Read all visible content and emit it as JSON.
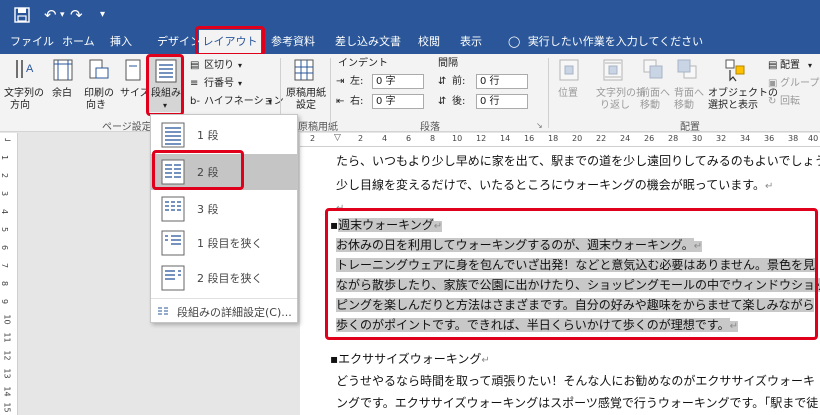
{
  "quick_access": {
    "undo": "↶",
    "redo": "↷",
    "more": "▾"
  },
  "tabs": [
    {
      "label": "ファイル"
    },
    {
      "label": "ホーム"
    },
    {
      "label": "挿入"
    },
    {
      "label": "デザイン"
    },
    {
      "label": "レイアウト"
    },
    {
      "label": "参考資料"
    },
    {
      "label": "差し込み文書"
    },
    {
      "label": "校閲"
    },
    {
      "label": "表示"
    }
  ],
  "tell_me": "実行したい作業を入力してください",
  "ribbon": {
    "page_setup": {
      "text_direction": [
        "文字列の",
        "方向"
      ],
      "margins": "余白",
      "orientation": [
        "印刷の",
        "向き"
      ],
      "size": "サイズ",
      "columns": "段組み",
      "breaks": "区切り",
      "line_numbers": "行番号",
      "hyphenation": "ハイフネーション",
      "group_label": "ページ設定"
    },
    "manuscript": {
      "button": [
        "原稿用紙",
        "設定"
      ],
      "group_label": "原稿用紙"
    },
    "paragraph": {
      "indent_label": "インデント",
      "spacing_label": "間隔",
      "left": "左:",
      "right": "右:",
      "before": "前:",
      "after": "後:",
      "left_value": "0 字",
      "right_value": "0 字",
      "before_value": "0 行",
      "after_value": "0 行",
      "group_label": "段落"
    },
    "arrange": {
      "position": "位置",
      "wrap": [
        "文字列の折",
        "り返し"
      ],
      "forward": [
        "前面へ",
        "移動"
      ],
      "backward": [
        "背面へ",
        "移動"
      ],
      "selection": [
        "オブジェクトの",
        "選択と表示"
      ],
      "align": "配置",
      "group": "グループ化",
      "rotate": "回転",
      "group_label": "配置"
    }
  },
  "ruler_numbers": [
    "2",
    "2",
    "4",
    "6",
    "8",
    "10",
    "12",
    "14",
    "16",
    "18",
    "20",
    "22",
    "24",
    "26",
    "28",
    "30",
    "32",
    "34",
    "36",
    "38",
    "40"
  ],
  "vruler_numbers": [
    "1",
    "2",
    "3",
    "4",
    "5",
    "6",
    "7",
    "8",
    "9",
    "10",
    "11",
    "12",
    "13",
    "14",
    "15"
  ],
  "columns_menu": {
    "items": [
      {
        "label": "1 段"
      },
      {
        "label": "2 段"
      },
      {
        "label": "3 段"
      },
      {
        "label": "1 段目を狭く"
      },
      {
        "label": "2 段目を狭く"
      }
    ],
    "more": "段組みの詳細設定(C)..."
  },
  "document": {
    "top_lines": [
      "たら、いつもより少し早めに家を出て、駅までの道を少し遠回りしてみるのもよいでしょう。",
      "少し目線を変えるだけで、いたるところにウォーキングの機会が眠っています。"
    ],
    "sel_heading": "週末ウォーキング",
    "sel_lines": [
      "お休みの日を利用してウォーキングするのが、週末ウォーキング。",
      "トレーニングウェアに身を包んでいざ出発！などと意気込む必要はありません。景色を見",
      "ながら散歩したり、家族で公園に出かけたり、ショッピングモールの中でウィンドウショッ",
      "ピングを楽しんだりと方法はさまざまです。自分の好みや趣味をからませて楽しみながら",
      "歩くのがポイントです。できれば、半日くらいかけて歩くのが理想です。"
    ],
    "exercise_heading": "エクササイズウォーキング",
    "exercise_lines": [
      "どうせやるなら時間を取って頑張りたい！そんな人にお勧めなのがエクササイズウォーキ",
      "ングです。エクササイズウォーキングはスポーツ感覚で行うウォーキングです。「駅まで徒"
    ],
    "return_mark": "↵",
    "bullet": "▪"
  }
}
